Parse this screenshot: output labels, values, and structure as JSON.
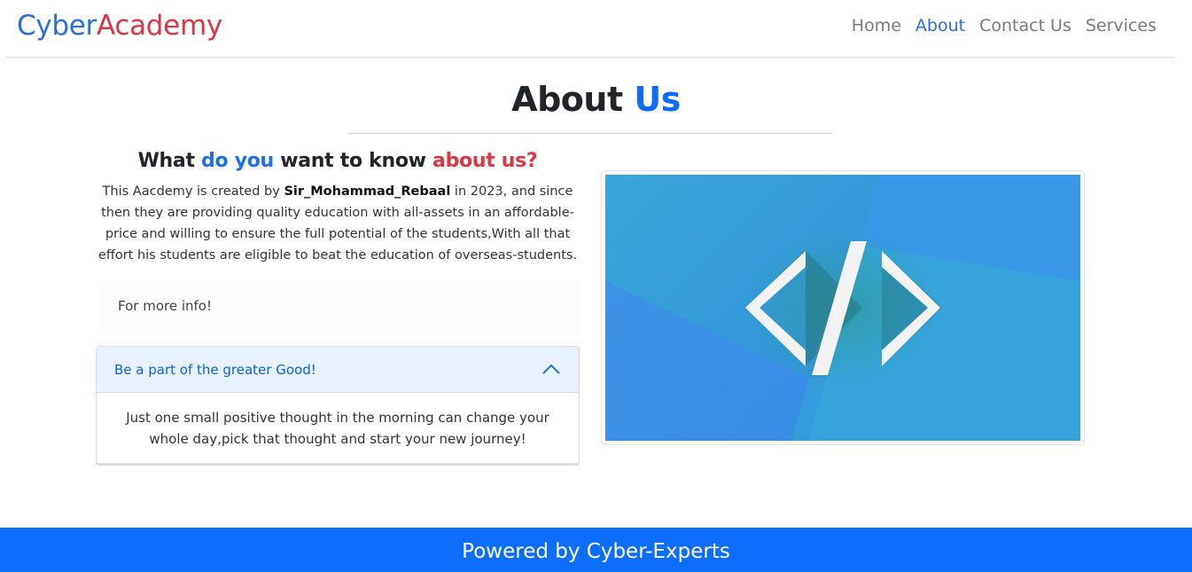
{
  "navbar": {
    "brand_part1": "Cyber",
    "brand_part2": "Academy",
    "links": [
      {
        "label": "Home",
        "active": false
      },
      {
        "label": "About",
        "active": true
      },
      {
        "label": "Contact Us",
        "active": false
      },
      {
        "label": "Services",
        "active": false
      }
    ]
  },
  "heading": {
    "part1": "About",
    "part2": "Us"
  },
  "intro": {
    "q_part1": "What",
    "q_part2": "do you",
    "q_part3": "want to know",
    "q_part4": "about us?",
    "text_before": "This Aacdemy is created by",
    "author": "Sir_Mohammad_Rebaal",
    "text_after": "in 2023, and since then they are providing quality education with all-assets in an affordable-price and willing to ensure the full potential of the students,With all that effort his students are eligible to beat the education of overseas-students."
  },
  "info_box": {
    "label": "For more info!"
  },
  "accordion": {
    "header": "Be a part of the greater Good!",
    "body": "Just one small positive thought in the morning can change your whole day,pick that thought and start your new journey!",
    "expanded": true
  },
  "image": {
    "icon": "code-brackets-icon"
  },
  "footer": {
    "text": "Powered by Cyber-Experts"
  },
  "colors": {
    "primary": "#0d6efd",
    "brand_blue": "#2a6fe0",
    "accent_red": "#dc3545"
  }
}
